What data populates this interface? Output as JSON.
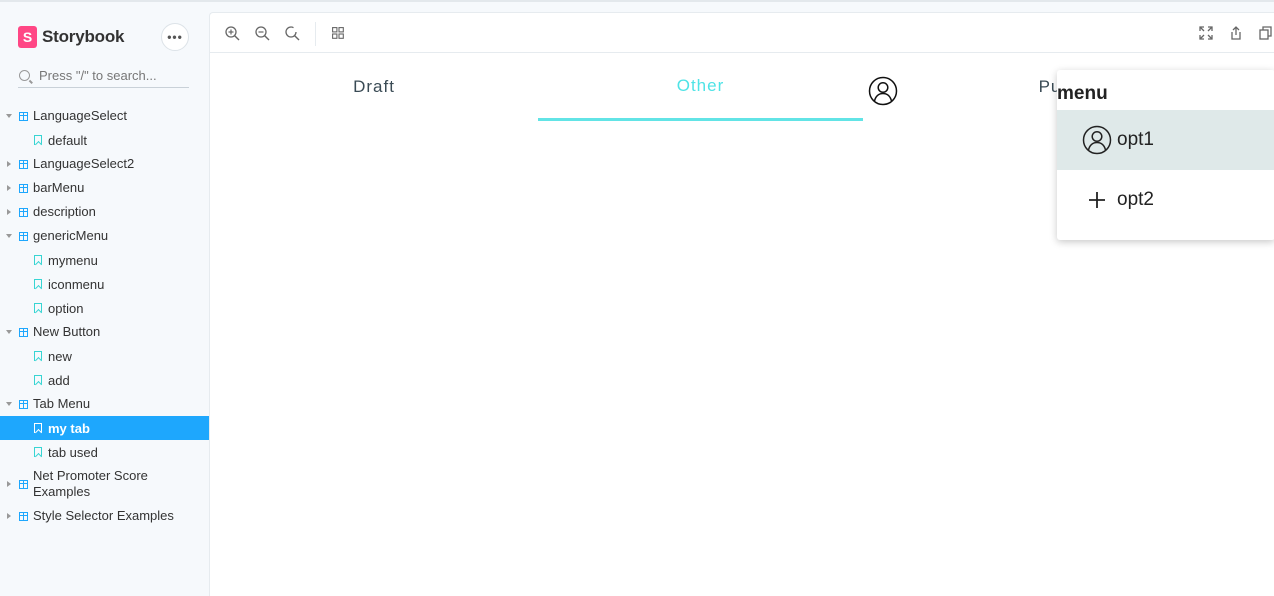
{
  "sidebar": {
    "brand": "Storybook",
    "brand_logo_letter": "S",
    "menu_button": "•••",
    "search_placeholder": "Press \"/\" to search...",
    "tree": [
      {
        "label": "LanguageSelect",
        "kind": "group",
        "expanded": true
      },
      {
        "label": "default",
        "kind": "story"
      },
      {
        "label": "LanguageSelect2",
        "kind": "group",
        "expanded": false
      },
      {
        "label": "barMenu",
        "kind": "group",
        "expanded": false
      },
      {
        "label": "description",
        "kind": "group",
        "expanded": false
      },
      {
        "label": "genericMenu",
        "kind": "group",
        "expanded": true
      },
      {
        "label": "mymenu",
        "kind": "story"
      },
      {
        "label": "iconmenu",
        "kind": "story"
      },
      {
        "label": "option",
        "kind": "story"
      },
      {
        "label": "New Button",
        "kind": "group",
        "expanded": true
      },
      {
        "label": "new",
        "kind": "story"
      },
      {
        "label": "add",
        "kind": "story"
      },
      {
        "label": "Tab Menu",
        "kind": "group",
        "expanded": true
      },
      {
        "label": "my tab",
        "kind": "story",
        "active": true
      },
      {
        "label": "tab used",
        "kind": "story"
      },
      {
        "label": "Net Promoter Score Examples",
        "kind": "group",
        "expanded": false
      },
      {
        "label": "Style Selector Examples",
        "kind": "group",
        "expanded": false
      }
    ]
  },
  "toolbar": {
    "left_icons": [
      "zoom-in-icon",
      "zoom-out-icon",
      "reset-zoom-icon",
      "grid-icon"
    ],
    "right_icons": [
      "fullscreen-icon",
      "share-icon",
      "copy-icon"
    ]
  },
  "tabs": {
    "items": [
      {
        "label": "Draft",
        "active": false
      },
      {
        "label": "Other",
        "active": true
      },
      {
        "label": "Pu",
        "active": false
      }
    ],
    "active_color": "#4fe3e6"
  },
  "dropdown": {
    "title": "menu",
    "items": [
      {
        "label": "opt1",
        "icon": "user-icon",
        "selected": true
      },
      {
        "label": "opt2",
        "icon": "plus-icon",
        "selected": false
      }
    ]
  },
  "colors": {
    "accent": "#1ea7fd",
    "brand": "#ff4785",
    "tab_active": "#4fe3e6",
    "selected_item_bg": "#dfe9e9"
  }
}
